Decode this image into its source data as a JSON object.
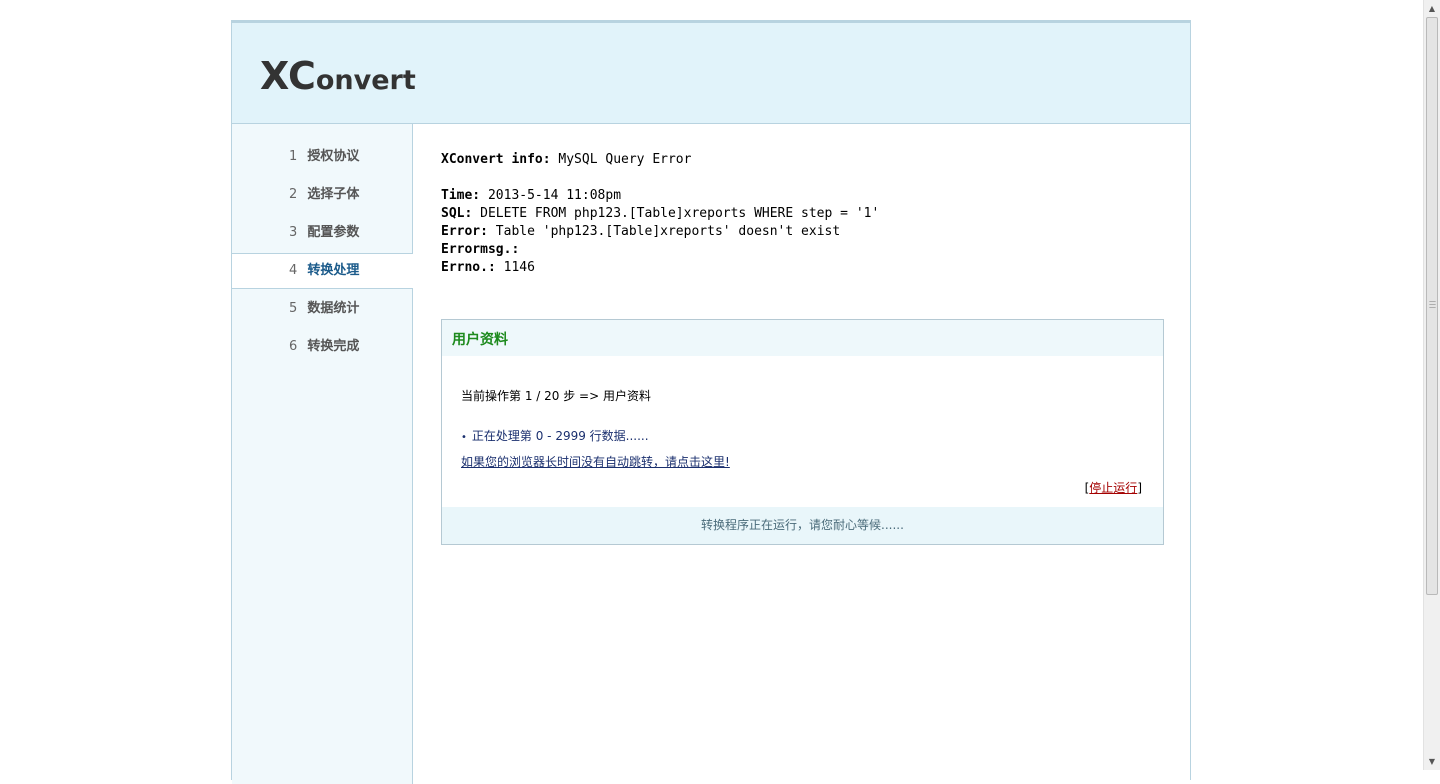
{
  "header": {
    "logo_big": "XC",
    "logo_rest": "onvert"
  },
  "sidebar": {
    "items": [
      {
        "num": "1",
        "label": "授权协议"
      },
      {
        "num": "2",
        "label": "选择子体"
      },
      {
        "num": "3",
        "label": "配置参数"
      },
      {
        "num": "4",
        "label": "转换处理",
        "active": true
      },
      {
        "num": "5",
        "label": "数据统计"
      },
      {
        "num": "6",
        "label": "转换完成"
      }
    ]
  },
  "error": {
    "title_key": "XConvert info:",
    "title_value": " MySQL Query Error",
    "time_key": "Time:",
    "time_value": " 2013-5-14 11:08pm",
    "sql_key": "SQL:",
    "sql_value": " DELETE FROM php123.[Table]xreports WHERE step = '1'",
    "error_key": "Error:",
    "error_value": " Table 'php123.[Table]xreports' doesn't exist",
    "errormsg_key": "Errormsg.:",
    "errormsg_value": "",
    "errno_key": "Errno.:",
    "errno_value": " 1146"
  },
  "panel": {
    "title": "用户资料",
    "step_text": "当前操作第 1 / 20 步 => 用户资料",
    "processing_text": "正在处理第 0 - 2999 行数据......",
    "bullet": "•",
    "redirect_link": "如果您的浏览器长时间没有自动跳转，请点击这里!",
    "stop_open": "[",
    "stop_label": "停止运行",
    "stop_close": "]",
    "footer": "转换程序正在运行，请您耐心等候......"
  },
  "scrollbar": {
    "up_icon": "▲",
    "down_icon": "▼"
  }
}
